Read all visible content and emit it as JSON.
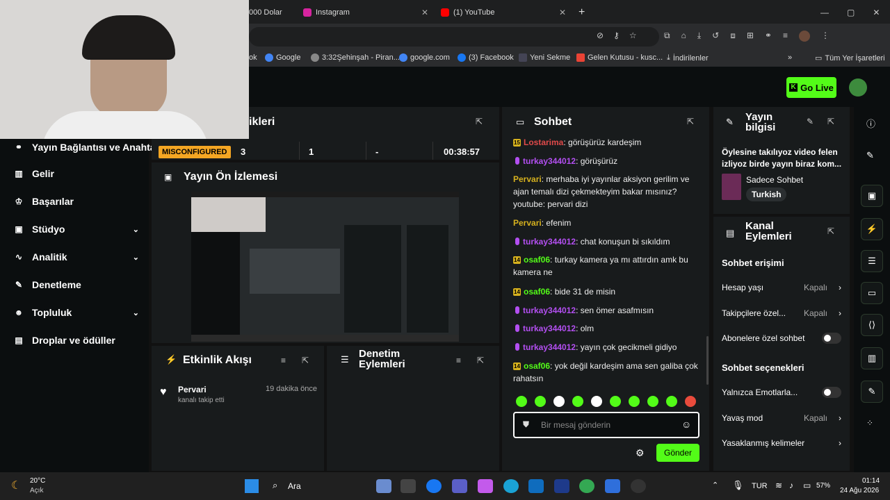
{
  "browser": {
    "tabs": [
      {
        "label": "000 Dolar",
        "icon": "tab-icon"
      },
      {
        "label": "Instagram",
        "icon": "instagram-icon"
      },
      {
        "label": "(1) YouTube",
        "icon": "youtube-icon"
      }
    ],
    "new_tab": "+",
    "bookmarks": [
      "ok",
      "Google",
      "3:32Şehinşah - Piran...",
      "google.com",
      "(3) Facebook",
      "Yeni Sekme",
      "Gelen Kutusu - kusc...",
      "İndirilenler",
      "»",
      "Tüm Yer İşaretleri"
    ]
  },
  "header": {
    "go_live": "Go Live"
  },
  "nav": {
    "items": [
      {
        "label": "Yayın Bağlantısı ve Anahtar",
        "icon": "link-icon",
        "chevron": ""
      },
      {
        "label": "Gelir",
        "icon": "chart-icon",
        "chevron": ""
      },
      {
        "label": "Başarılar",
        "icon": "trophy-icon",
        "chevron": ""
      },
      {
        "label": "Stüdyo",
        "icon": "studio-icon",
        "chevron": "⌄"
      },
      {
        "label": "Analitik",
        "icon": "analytics-icon",
        "chevron": "⌄"
      },
      {
        "label": "Denetleme",
        "icon": "wrench-icon",
        "chevron": ""
      },
      {
        "label": "Topluluk",
        "icon": "community-icon",
        "chevron": "⌄"
      },
      {
        "label": "Droplar ve ödüller",
        "icon": "gift-icon",
        "chevron": ""
      }
    ]
  },
  "stats": {
    "title_partial": "ikleri",
    "status": "MISCONFIGURED",
    "viewers": "3",
    "followers": "1",
    "subs": "-",
    "time": "00:38:57"
  },
  "preview": {
    "title": "Yayın Ön İzlemesi"
  },
  "activity": {
    "title": "Etkinlik Akışı",
    "user": "Pervari",
    "time": "19 dakika önce",
    "action": "kanalı takip etti"
  },
  "moderation": {
    "title": "Denetim Eylemleri"
  },
  "chat": {
    "title": "Sohbet",
    "messages": [
      {
        "badge": "15",
        "user": "Lostarima",
        "color": "#e04a4a",
        "text": ": görüşürüz kardeşim",
        "mic": false
      },
      {
        "badge": "",
        "user": "turkay344012",
        "color": "#b34ff1",
        "text": ": görüşürüz",
        "mic": true
      },
      {
        "badge": "",
        "user": "Pervari",
        "color": "#d6b11e",
        "text": ": merhaba iyi yayınlar aksiyon gerilim ve ajan temalı dizi çekmekteyim bakar mısınız? youtube: pervari dizi",
        "mic": false
      },
      {
        "badge": "",
        "user": "Pervari",
        "color": "#d6b11e",
        "text": ": efenim",
        "mic": false
      },
      {
        "badge": "",
        "user": "turkay344012",
        "color": "#b34ff1",
        "text": ": chat konuşun bi sıkıldım",
        "mic": true
      },
      {
        "badge": "14",
        "user": "osaf06",
        "color": "#53fc18",
        "text": ": turkay kamera ya mı attırdın amk bu kamera ne",
        "mic": false
      },
      {
        "badge": "14",
        "user": "osaf06",
        "color": "#53fc18",
        "text": ": bide 31 de misin",
        "mic": false
      },
      {
        "badge": "",
        "user": "turkay344012",
        "color": "#b34ff1",
        "text": ": sen ömer asafmısın",
        "mic": true
      },
      {
        "badge": "",
        "user": "turkay344012",
        "color": "#b34ff1",
        "text": ": olm",
        "mic": true
      },
      {
        "badge": "",
        "user": "turkay344012",
        "color": "#b34ff1",
        "text": ": yayın çok gecikmeli gidiyo",
        "mic": true
      },
      {
        "badge": "14",
        "user": "osaf06",
        "color": "#53fc18",
        "text": ": yok değil kardeşim ama sen galiba çok rahatsın",
        "mic": false
      }
    ],
    "placeholder": "Bir mesaj gönderin",
    "send": "Gönder"
  },
  "stream_info": {
    "title": "Yayın bilgisi",
    "stream_title": "Öylesine takılıyoz video felen izliyoz birde yayın biraz kom...",
    "category": "Sadece Sohbet",
    "language": "Turkish"
  },
  "channel_actions": {
    "title": "Kanal Eylemleri",
    "chat_access": "Sohbet erişimi",
    "account_age": "Hesap yaşı",
    "account_age_val": "Kapalı",
    "followers_only": "Takipçilere özel...",
    "followers_only_val": "Kapalı",
    "subs_only": "Abonelere özel sohbet",
    "chat_options": "Sohbet seçenekleri",
    "emote_only": "Yalnızca Emotlarla...",
    "slow_mode": "Yavaş mod",
    "slow_mode_val": "Kapalı",
    "banned_words": "Yasaklanmış kelimeler"
  },
  "taskbar": {
    "weather_temp": "20°C",
    "weather_desc": "Açık",
    "search": "Ara",
    "lang": "TUR",
    "battery": "57%",
    "time": "01:14",
    "date": "24 Ağu 2026"
  },
  "colors": {
    "kick_green": "#53fc18",
    "bg": "#0b0e0f",
    "panel": "#181b1c"
  }
}
